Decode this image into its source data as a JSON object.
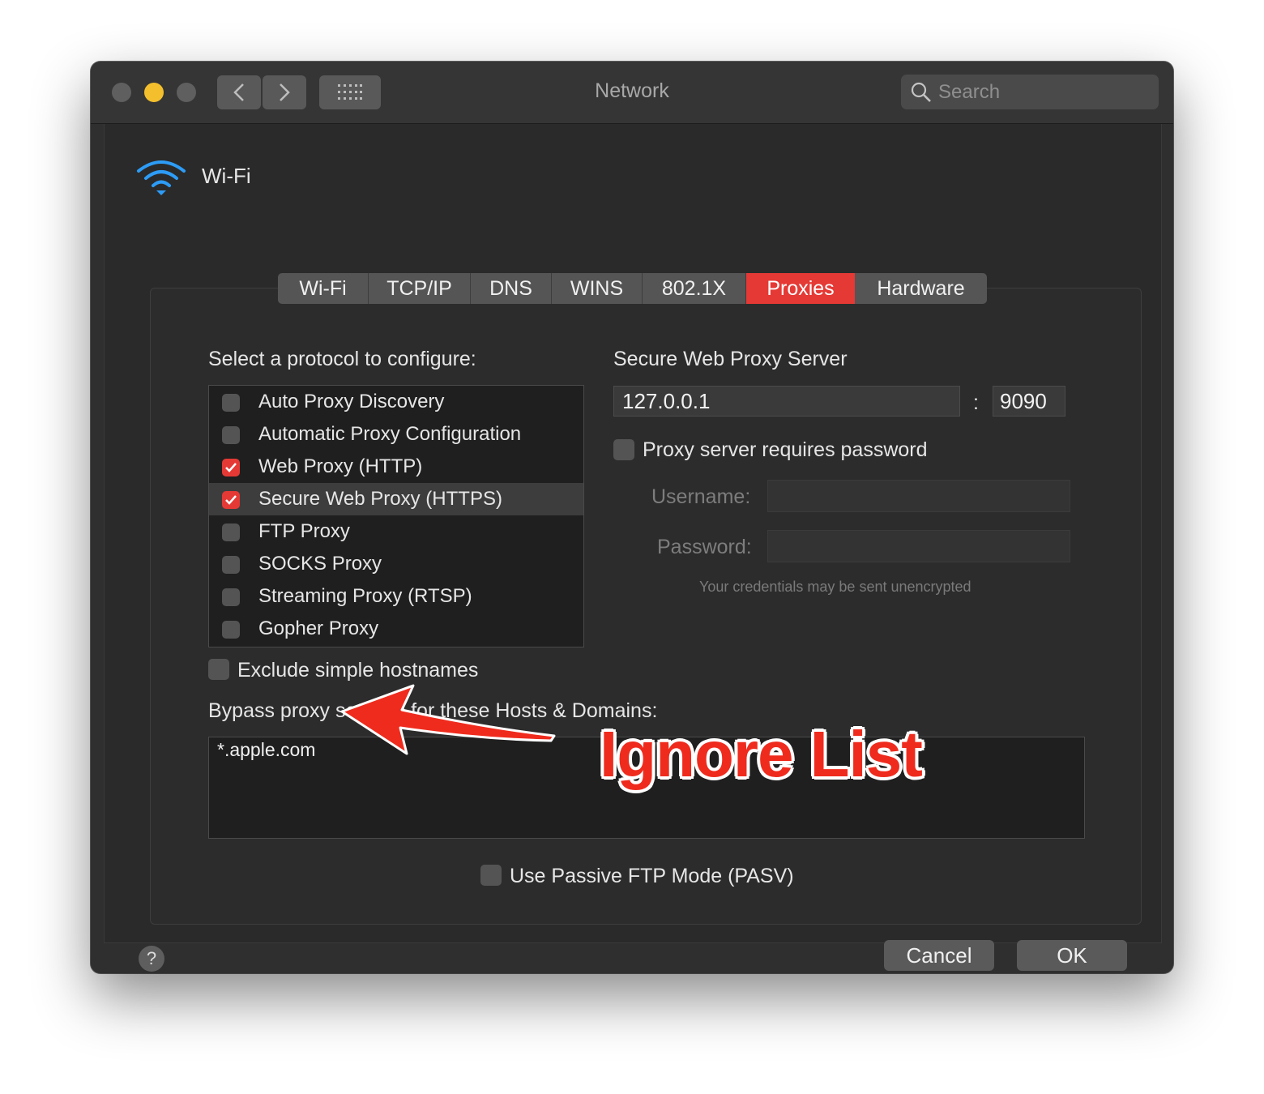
{
  "window": {
    "title": "Network"
  },
  "toolbar": {
    "search_placeholder": "Search"
  },
  "interface": {
    "name": "Wi-Fi"
  },
  "tabs": [
    {
      "label": "Wi-Fi",
      "active": false
    },
    {
      "label": "TCP/IP",
      "active": false
    },
    {
      "label": "DNS",
      "active": false
    },
    {
      "label": "WINS",
      "active": false
    },
    {
      "label": "802.1X",
      "active": false
    },
    {
      "label": "Proxies",
      "active": true
    },
    {
      "label": "Hardware",
      "active": false
    }
  ],
  "protocols": {
    "heading": "Select a protocol to configure:",
    "items": [
      {
        "label": "Auto Proxy Discovery",
        "checked": false,
        "selected": false
      },
      {
        "label": "Automatic Proxy Configuration",
        "checked": false,
        "selected": false
      },
      {
        "label": "Web Proxy (HTTP)",
        "checked": true,
        "selected": false
      },
      {
        "label": "Secure Web Proxy (HTTPS)",
        "checked": true,
        "selected": true
      },
      {
        "label": "FTP Proxy",
        "checked": false,
        "selected": false
      },
      {
        "label": "SOCKS Proxy",
        "checked": false,
        "selected": false
      },
      {
        "label": "Streaming Proxy (RTSP)",
        "checked": false,
        "selected": false
      },
      {
        "label": "Gopher Proxy",
        "checked": false,
        "selected": false
      }
    ]
  },
  "server": {
    "heading": "Secure Web Proxy Server",
    "host": "127.0.0.1",
    "separator": ":",
    "port": "9090",
    "requires_password_label": "Proxy server requires password",
    "requires_password": false,
    "username_label": "Username:",
    "username": "",
    "password_label": "Password:",
    "password": "",
    "note": "Your credentials may be sent unencrypted"
  },
  "exclude_simple": {
    "label": "Exclude simple hostnames",
    "checked": false
  },
  "bypass": {
    "heading": "Bypass proxy settings for these Hosts & Domains:",
    "value": "*.apple.com"
  },
  "passive_ftp": {
    "label": "Use Passive FTP Mode (PASV)",
    "checked": false
  },
  "buttons": {
    "cancel": "Cancel",
    "ok": "OK",
    "help": "?"
  },
  "annotation": {
    "text": "Ignore List",
    "color": "#ef2b1d"
  },
  "colors": {
    "accent": "#e53935",
    "close": "#5f5f5f",
    "minimize": "#f4bf2c",
    "zoom": "#5f5f5f"
  }
}
